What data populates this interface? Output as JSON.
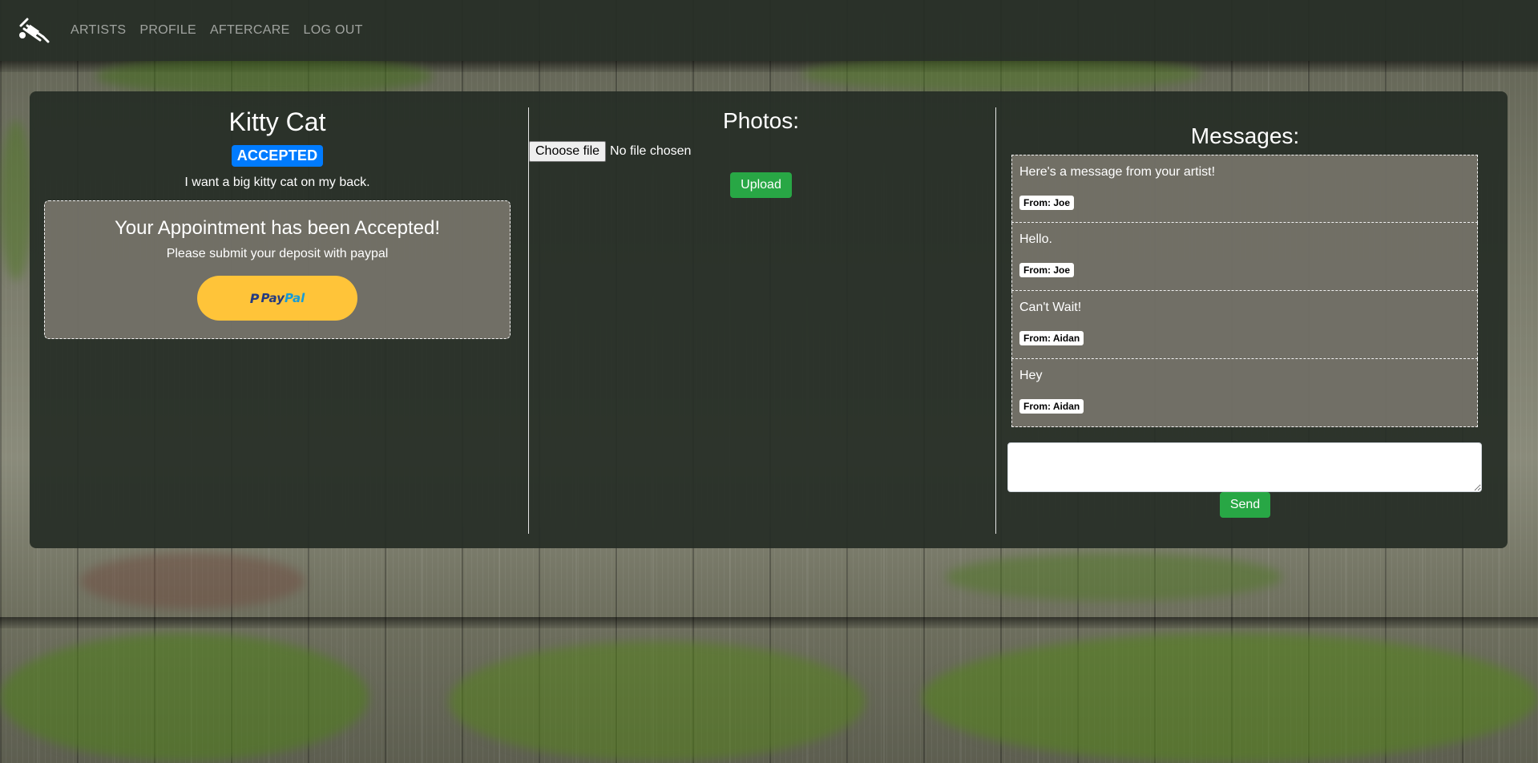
{
  "nav": {
    "logo_icon": "tattoo-machine-icon",
    "links": [
      "ARTISTS",
      "PROFILE",
      "AFTERCARE",
      "LOG OUT"
    ]
  },
  "appointment": {
    "title": "Kitty Cat",
    "status": "ACCEPTED",
    "description": "I want a big kitty cat on my back.",
    "notice_title": "Your Appointment has been Accepted!",
    "notice_sub": "Please submit your deposit with paypal",
    "paypal_label_a": "Pay",
    "paypal_label_b": "Pal"
  },
  "photos": {
    "title": "Photos:",
    "choose_label": "Choose file",
    "file_status": "No file chosen",
    "upload_label": "Upload"
  },
  "messages": {
    "title": "Messages:",
    "items": [
      {
        "text": "Here's a message from your artist!",
        "from": "From: Joe"
      },
      {
        "text": "Hello.",
        "from": "From: Joe"
      },
      {
        "text": "Can't Wait!",
        "from": "From: Aidan"
      },
      {
        "text": "Hey",
        "from": "From: Aidan"
      }
    ],
    "input_value": "",
    "send_label": "Send"
  },
  "colors": {
    "status_badge": "#007bff",
    "button_green": "#28a745",
    "paypal_yellow": "#ffc439",
    "panel_bg": "#262d26"
  }
}
